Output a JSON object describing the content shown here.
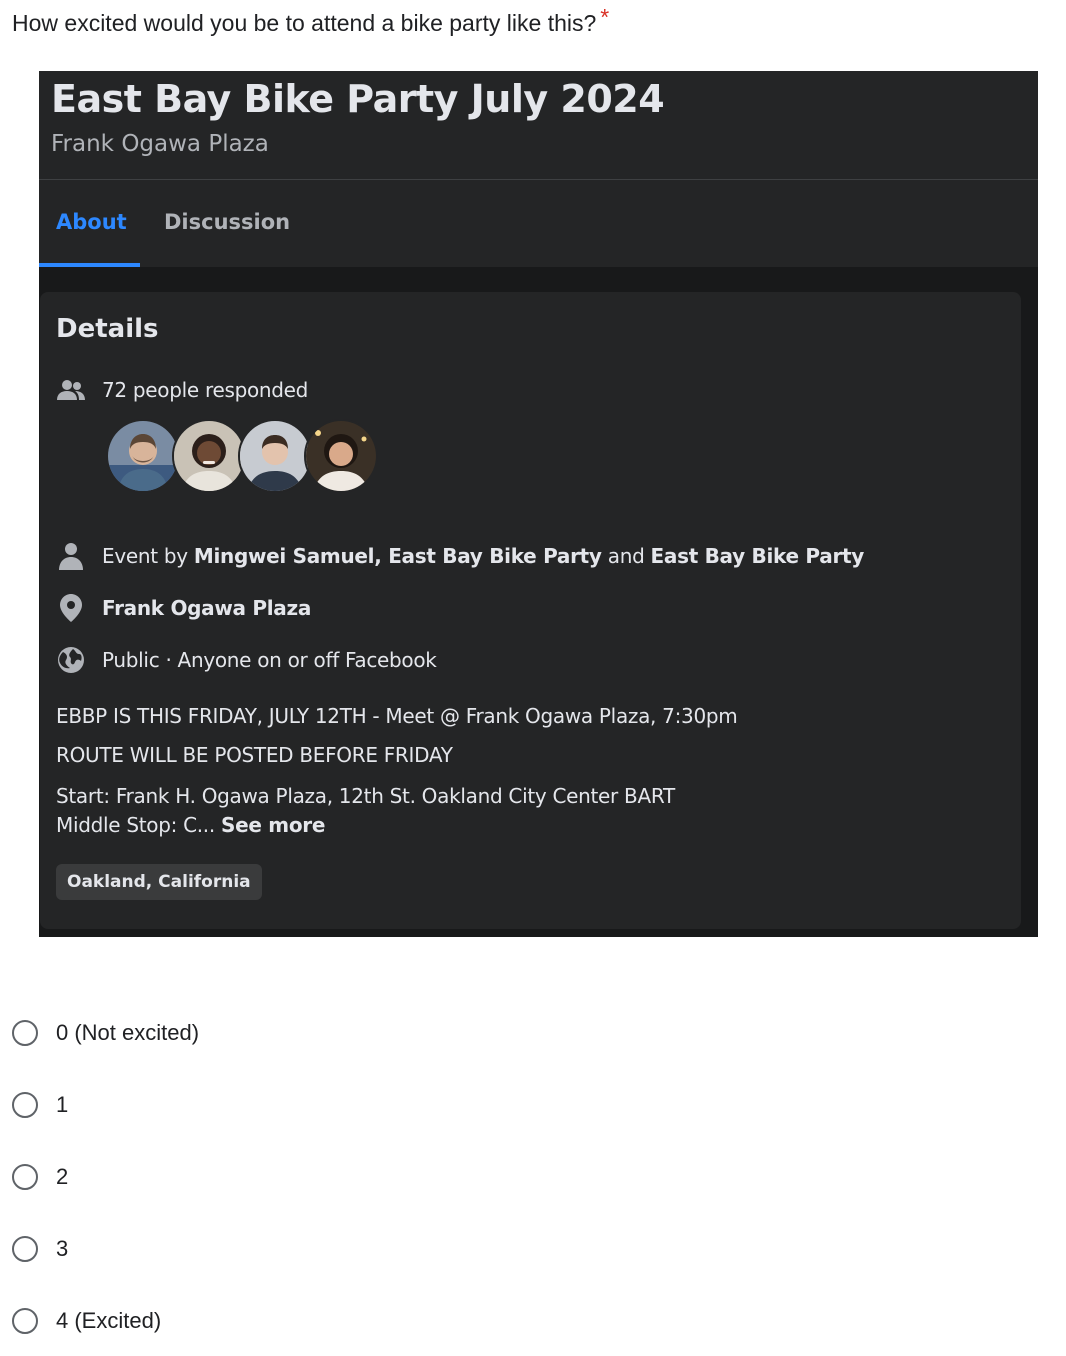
{
  "question": {
    "text": "How excited would you be to attend a bike party like this?",
    "required_mark": "*"
  },
  "event": {
    "title": "East Bay Bike Party July 2024",
    "subtitle": "Frank Ogawa Plaza",
    "tabs": [
      {
        "label": "About",
        "active": true
      },
      {
        "label": "Discussion",
        "active": false
      }
    ],
    "details_heading": "Details",
    "responded": "72 people responded",
    "host_prefix": "Event by",
    "host_names": "Mingwei Samuel, East Bay Bike Party",
    "host_and": "and",
    "host_last": "East Bay Bike Party",
    "location": "Frank Ogawa Plaza",
    "privacy": "Public · Anyone on or off Facebook",
    "desc_lines": [
      "EBBP IS THIS FRIDAY, JULY 12TH - Meet @ Frank Ogawa Plaza, 7:30pm",
      "ROUTE WILL BE POSTED BEFORE FRIDAY",
      "Start: Frank H. Ogawa Plaza, 12th St. Oakland City Center BART",
      "Middle Stop: C..."
    ],
    "see_more": "See more",
    "location_chip": "Oakland, California"
  },
  "options": [
    {
      "label": "0 (Not excited)"
    },
    {
      "label": "1"
    },
    {
      "label": "2"
    },
    {
      "label": "3"
    },
    {
      "label": "4 (Excited)"
    }
  ],
  "colors": {
    "accent": "#2d88ff",
    "dark_bg": "#18191a",
    "card_bg": "#242526",
    "required": "#d93025"
  }
}
